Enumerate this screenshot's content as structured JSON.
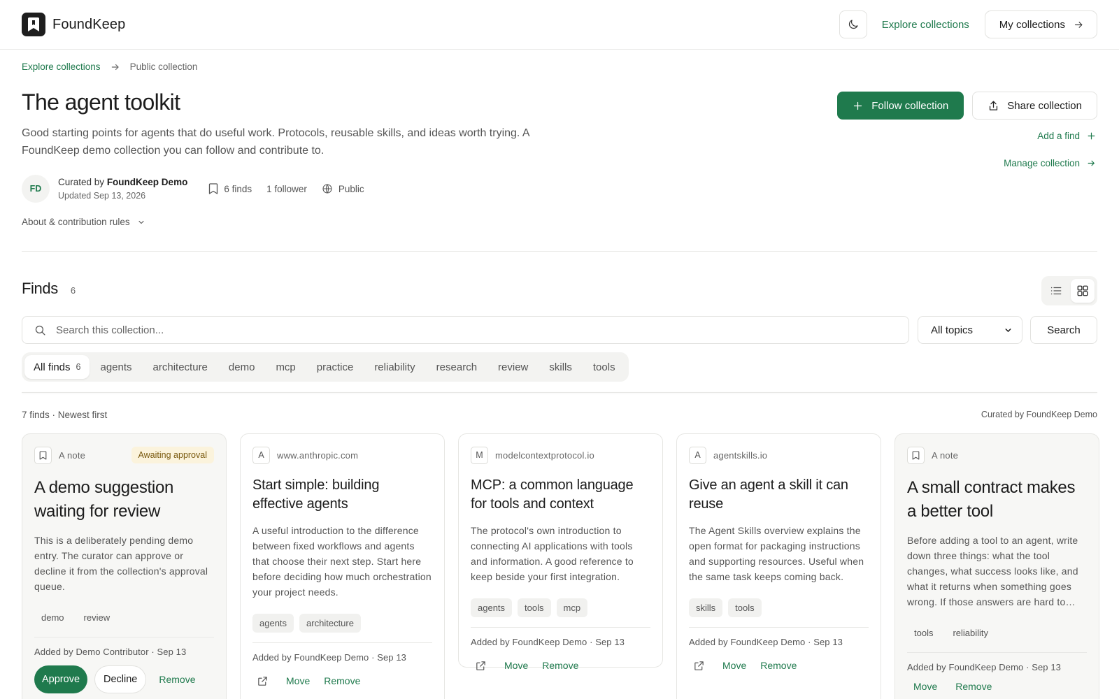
{
  "app": {
    "name": "FoundKeep",
    "nav_explore": "Explore collections",
    "nav_my_collections": "My collections"
  },
  "breadcrumb": {
    "parent": "Explore collections",
    "current": "Public collection"
  },
  "collection": {
    "title": "The agent toolkit",
    "description": "Good starting points for agents that do useful work. Protocols, reusable skills, and ideas worth trying. A FoundKeep demo collection you can follow and contribute to.",
    "avatar_initials": "FD",
    "curated_by_prefix": "Curated by",
    "curator_name": "FoundKeep Demo",
    "updated": "Updated Sep 13, 2026",
    "finds_count": "6 finds",
    "followers": "1 follower",
    "visibility": "Public",
    "about_label": "About & contribution rules",
    "follow_label": "Follow collection",
    "share_label": "Share collection",
    "add_find_label": "Add a find",
    "manage_label": "Manage collection"
  },
  "finds": {
    "title": "Finds",
    "count": "6",
    "search_placeholder": "Search this collection...",
    "topic_selected": "All topics",
    "search_button": "Search",
    "tabs": [
      {
        "label": "All finds",
        "count": "6"
      },
      {
        "label": "agents"
      },
      {
        "label": "architecture"
      },
      {
        "label": "demo"
      },
      {
        "label": "mcp"
      },
      {
        "label": "practice"
      },
      {
        "label": "reliability"
      },
      {
        "label": "research"
      },
      {
        "label": "review"
      },
      {
        "label": "skills"
      },
      {
        "label": "tools"
      }
    ],
    "list_meta": "7 finds · Newest first",
    "list_curator": "Curated by FoundKeep Demo"
  },
  "cards": [
    {
      "source_icon": "bookmark-icon",
      "source": "A note",
      "badge": "Awaiting approval",
      "title": "A demo suggestion waiting for review",
      "description": "This is a deliberately pending demo entry. The curator can approve or decline it from the collection's approval queue.",
      "tags": [
        "demo",
        "review"
      ],
      "added": "Added by Demo Contributor · Sep 13",
      "approve_label": "Approve",
      "decline_label": "Decline",
      "remove_label": "Remove"
    },
    {
      "source_icon": "A",
      "source": "www.anthropic.com",
      "title": "Start simple: building effective agents",
      "description": "A useful introduction to the difference between fixed workflows and agents that choose their next step. Start here before deciding how much orchestration your project needs.",
      "tags": [
        "agents",
        "architecture"
      ],
      "added": "Added by FoundKeep Demo · Sep 13",
      "move_label": "Move",
      "remove_label": "Remove"
    },
    {
      "source_icon": "M",
      "source": "modelcontextprotocol.io",
      "title": "MCP: a common language for tools and context",
      "description": "The protocol's own introduction to connecting AI applications with tools and information. A good reference to keep beside your first integration.",
      "tags": [
        "agents",
        "tools",
        "mcp"
      ],
      "added": "Added by FoundKeep Demo · Sep 13",
      "move_label": "Move",
      "remove_label": "Remove"
    },
    {
      "source_icon": "A",
      "source": "agentskills.io",
      "title": "Give an agent a skill it can reuse",
      "description": "The Agent Skills overview explains the open format for packaging instructions and supporting resources. Useful when the same task keeps coming back.",
      "tags": [
        "skills",
        "tools"
      ],
      "added": "Added by FoundKeep Demo · Sep 13",
      "move_label": "Move",
      "remove_label": "Remove"
    },
    {
      "source_icon": "bookmark-icon",
      "source": "A note",
      "title": "A small contract makes a better tool",
      "description": "Before adding a tool to an agent, write down three things: what the tool changes, what success looks like, and what it returns when something goes wrong. If those answers are hard to…",
      "tags": [
        "tools",
        "reliability"
      ],
      "added": "Added by FoundKeep Demo · Sep 13",
      "move_label": "Move",
      "remove_label": "Remove"
    }
  ],
  "colors": {
    "accent": "#1f7a4d",
    "pending_bg": "#fbf3dc"
  }
}
